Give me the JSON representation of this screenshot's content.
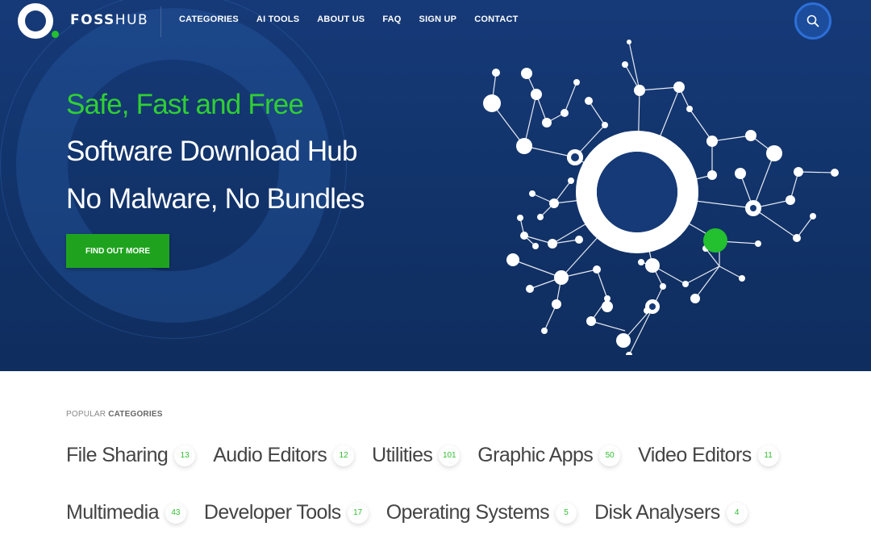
{
  "brand": {
    "logo_text_bold": "FOSS",
    "logo_text_light": "HUB"
  },
  "nav": {
    "items": [
      {
        "label": "CATEGORIES"
      },
      {
        "label": "AI TOOLS"
      },
      {
        "label": "ABOUT US"
      },
      {
        "label": "FAQ"
      },
      {
        "label": "SIGN UP"
      },
      {
        "label": "CONTACT"
      }
    ],
    "search_icon": "search-icon"
  },
  "hero": {
    "line1": "Safe, Fast and Free",
    "line2": "Software Download Hub",
    "line3": "No Malware, No Bundles",
    "cta_label": "FIND OUT MORE"
  },
  "popular": {
    "label_prefix": "POPULAR",
    "label_bold": "CATEGORIES",
    "row1": [
      {
        "name": "File Sharing",
        "count": "13"
      },
      {
        "name": "Audio Editors",
        "count": "12"
      },
      {
        "name": "Utilities",
        "count": "101"
      },
      {
        "name": "Graphic Apps",
        "count": "50"
      },
      {
        "name": "Video Editors",
        "count": "11"
      }
    ],
    "row2": [
      {
        "name": "Multimedia",
        "count": "43"
      },
      {
        "name": "Developer Tools",
        "count": "17"
      },
      {
        "name": "Operating Systems",
        "count": "5"
      },
      {
        "name": "Disk Analysers",
        "count": "4"
      }
    ]
  },
  "colors": {
    "hero_bg": "#163a78",
    "accent_green": "#23c02f",
    "cta_green": "#1fa31f",
    "count_green": "#2fbf2f"
  }
}
